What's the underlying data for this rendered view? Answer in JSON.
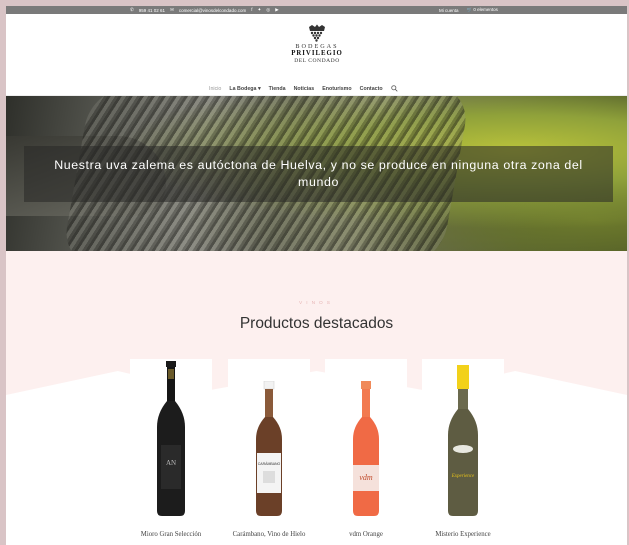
{
  "topbar": {
    "phone": "959 41 02 61",
    "email": "comercial@vinosdelcondado.com",
    "account": "Mi cuenta",
    "cart": "0 elementos"
  },
  "logo": {
    "line1": "BODEGAS",
    "line2": "PRIVILEGIO",
    "line3": "DEL CONDADO"
  },
  "nav": {
    "items": [
      "Inicio",
      "La Bodega",
      "Tienda",
      "Noticias",
      "Enoturismo",
      "Contacto"
    ]
  },
  "hero": {
    "caption": "Nuestra uva zalema es autóctona de Huelva, y no se produce en ninguna otra zona del mundo"
  },
  "section": {
    "eyebrow": "VINOS",
    "title": "Productos destacados"
  },
  "products": [
    {
      "name": "Mioro Gran Selección"
    },
    {
      "name": "Carámbano, Vino de Hielo"
    },
    {
      "name": "vdm Orange"
    },
    {
      "name": "Misterio Experience"
    }
  ],
  "colors": {
    "topbar": "#7a7a7a",
    "section_bg": "#fdf0ef",
    "eyebrow": "#e7b6b6"
  }
}
